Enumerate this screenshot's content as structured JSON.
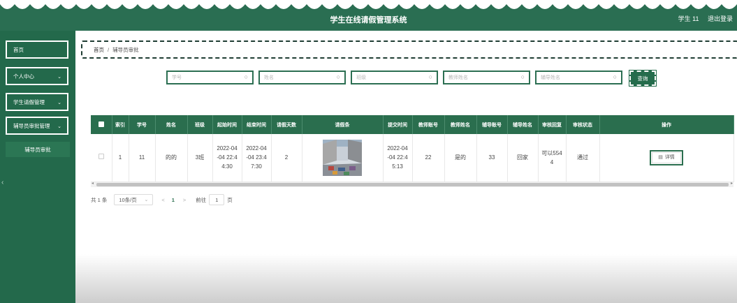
{
  "header": {
    "title": "学生在线请假管理系统",
    "user": "学生 11",
    "logout": "退出登录"
  },
  "sidebar": {
    "items": [
      {
        "label": "首页"
      },
      {
        "label": "个人中心"
      },
      {
        "label": "学生请假管理"
      },
      {
        "label": "辅导员审批管理"
      }
    ],
    "sub_item": "辅导员审批"
  },
  "breadcrumb": {
    "home": "首页",
    "separator": "/",
    "current": "辅导员审批"
  },
  "search": {
    "fields": [
      {
        "placeholder": "学号"
      },
      {
        "placeholder": "姓名"
      },
      {
        "placeholder": "班级"
      },
      {
        "placeholder": "教师姓名"
      },
      {
        "placeholder": "辅导姓名"
      }
    ],
    "button": "查询"
  },
  "table": {
    "headers": [
      "",
      "索引",
      "学号",
      "姓名",
      "班级",
      "起始时间",
      "结束时间",
      "请假天数",
      "请假条",
      "提交时间",
      "教师账号",
      "教师姓名",
      "辅导账号",
      "辅导姓名",
      "审核回复",
      "审核状态",
      "操作"
    ],
    "rows": [
      {
        "index": "1",
        "student_no": "11",
        "name": "的的",
        "class": "3班",
        "start": "2022-04\n-04 22:4\n4:30",
        "end": "2022-04\n-04 23:4\n7:30",
        "days": "2",
        "submitted": "2022-04\n-04 22:4\n5:13",
        "teacher_no": "22",
        "teacher_name": "是的",
        "counselor_no": "33",
        "counselor_name": "回家",
        "reply": "可以554\n4",
        "status": "通过",
        "action": "详情"
      }
    ]
  },
  "pagination": {
    "total": "共 1 条",
    "page_size": "10条/页",
    "prev": "<",
    "page": "1",
    "next": ">",
    "goto_label": "前往",
    "goto_value": "1",
    "goto_unit": "页"
  },
  "colors": {
    "brand": "#2a6e52",
    "sidebar": "#23694b",
    "accent": "#256c4c"
  }
}
